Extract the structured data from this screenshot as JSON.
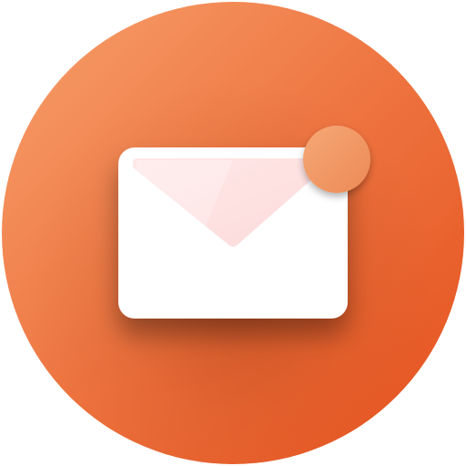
{
  "icon": {
    "name": "mail-notification-icon",
    "glyph": "envelope",
    "badge": "notification-dot",
    "colors": {
      "circle_light": "#F7A06C",
      "circle_mid": "#EE7440",
      "circle_dark": "#E4501C",
      "envelope_body": "#FFFFFF",
      "envelope_flap": "#FFE4E4",
      "badge_light": "#F6A876",
      "badge_dark": "#EC8A56"
    }
  }
}
